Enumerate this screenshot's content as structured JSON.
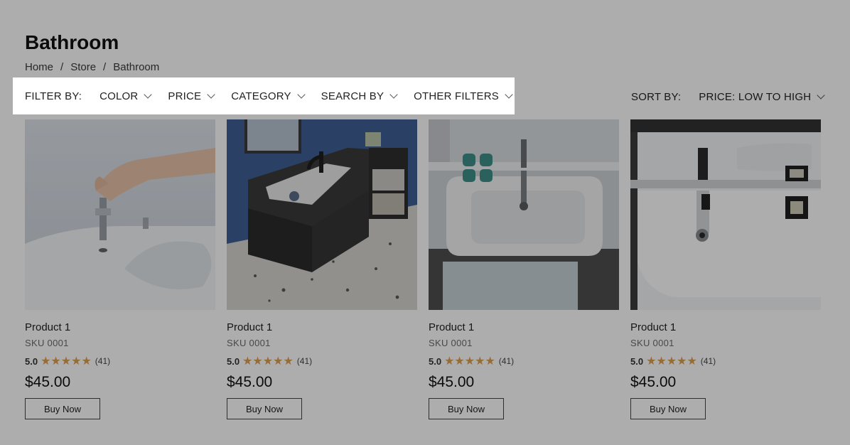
{
  "page": {
    "title": "Bathroom",
    "breadcrumb": [
      "Home",
      "Store",
      "Bathroom"
    ],
    "breadcrumb_separator": "/"
  },
  "filters": {
    "label": "FILTER BY:",
    "items": [
      "COLOR",
      "PRICE",
      "CATEGORY",
      "SEARCH BY",
      "OTHER FILTERS"
    ]
  },
  "sort": {
    "label": "SORT BY:",
    "value": "PRICE: LOW TO HIGH"
  },
  "products": [
    {
      "name": "Product 1",
      "sku": "SKU 0001",
      "rating": "5.0",
      "stars": 5,
      "reviews": "(41)",
      "price": "$45.00",
      "button": "Buy Now",
      "image": "toilet-bidet-faucet-install"
    },
    {
      "name": "Product 1",
      "sku": "SKU 0001",
      "rating": "5.0",
      "stars": 5,
      "reviews": "(41)",
      "price": "$45.00",
      "button": "Buy Now",
      "image": "dark-vanity-sink-blue-wall"
    },
    {
      "name": "Product 1",
      "sku": "SKU 0001",
      "rating": "5.0",
      "stars": 5,
      "reviews": "(41)",
      "price": "$45.00",
      "button": "Buy Now",
      "image": "white-basin-top-view"
    },
    {
      "name": "Product 1",
      "sku": "SKU 0001",
      "rating": "5.0",
      "stars": 5,
      "reviews": "(41)",
      "price": "$45.00",
      "button": "Buy Now",
      "image": "white-basin-chrome-faucet"
    }
  ],
  "colors": {
    "star": "#e0a050",
    "overlay": "rgba(0,0,0,0.32)"
  }
}
